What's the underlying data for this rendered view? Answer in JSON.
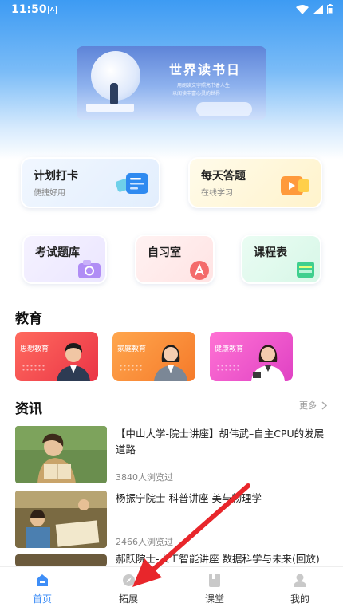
{
  "status_bar": {
    "time": "11:50",
    "badge": "A"
  },
  "banner": {
    "title": "世界读书日",
    "line1": "用朗读文字照亮书香人生",
    "line2": "以阅读丰富心灵的世界"
  },
  "features": {
    "plan": {
      "title": "计划打卡",
      "sub": "便捷好用"
    },
    "quiz": {
      "title": "每天答题",
      "sub": "在线学习"
    },
    "exam": {
      "title": "考试题库"
    },
    "study": {
      "title": "自习室"
    },
    "schedule": {
      "title": "课程表"
    }
  },
  "education": {
    "title": "教育",
    "cards": [
      {
        "label": "思想教育",
        "color": "#f0494f"
      },
      {
        "label": "家庭教育",
        "color": "#f98a3a"
      },
      {
        "label": "健康教育",
        "color": "#f35bd0"
      }
    ]
  },
  "news": {
    "title": "资讯",
    "more": "更多",
    "items": [
      {
        "title": "【中山大学-院士讲座】胡伟武–自主CPU的发展道路",
        "views": "3840人浏览过"
      },
      {
        "title": "杨振宁院士 科普讲座 美与物理学",
        "views": "2466人浏览过"
      },
      {
        "title": "郝跃院士-人工智能讲座 数据科学与未来(回放)",
        "views": ""
      }
    ]
  },
  "bottom_nav": [
    {
      "label": "首页",
      "icon": "home-icon"
    },
    {
      "label": "拓展",
      "icon": "compass-icon"
    },
    {
      "label": "课堂",
      "icon": "book-icon"
    },
    {
      "label": "我的",
      "icon": "user-icon"
    }
  ],
  "colors": {
    "accent": "#3e8ef7",
    "annotation_arrow": "#e8262b"
  }
}
